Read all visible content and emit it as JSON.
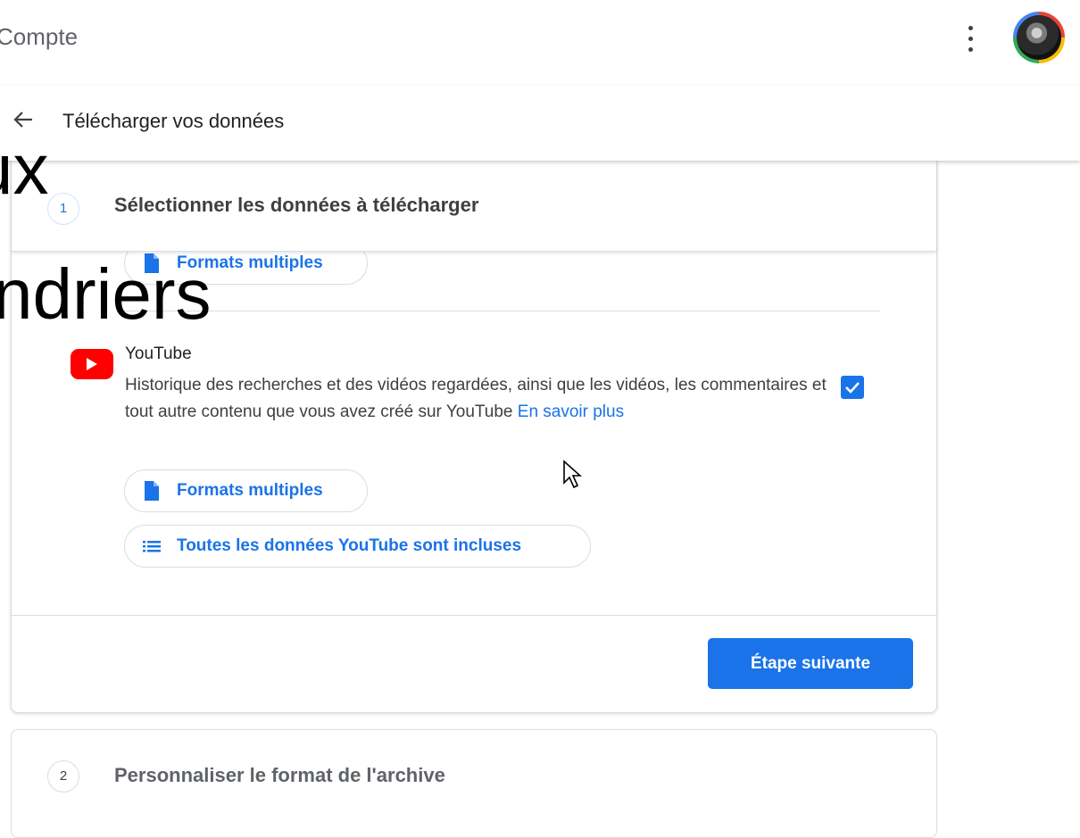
{
  "header": {
    "app_title": "Compte",
    "page_title": "Télécharger vos données"
  },
  "overlay": {
    "text_1": "ux",
    "text_2": "ndriers"
  },
  "step1": {
    "number": "1",
    "title": "Sélectionner les données à télécharger",
    "prev_item_chip": "Formats multiples",
    "product": {
      "name": "YouTube",
      "description": "Historique des recherches et des vidéos regardées, ainsi que les vidéos, les commentaires et tout autre contenu que vous avez créé sur YouTube ",
      "learn_more": "En savoir plus",
      "checked": true,
      "format_chip": "Formats multiples",
      "data_chip": "Toutes les données YouTube sont incluses"
    },
    "next_button": "Étape suivante"
  },
  "step2": {
    "number": "2",
    "title": "Personnaliser le format de l'archive"
  },
  "colors": {
    "accent": "#1a73e8",
    "youtube_red": "#ff0000",
    "divider": "#dadce0"
  },
  "icons": [
    "back-arrow-icon",
    "more-vert-icon",
    "file-icon",
    "list-icon",
    "youtube-icon",
    "check-icon",
    "cursor-icon"
  ]
}
